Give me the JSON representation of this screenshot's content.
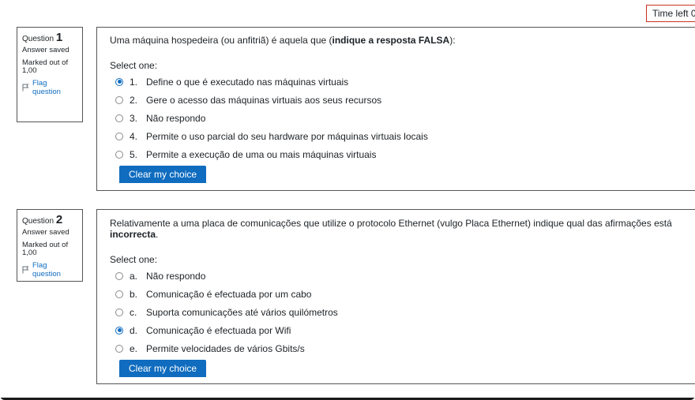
{
  "timer": {
    "text": "Time left 0"
  },
  "questions": [
    {
      "label": "Question",
      "number": "1",
      "state": "Answer saved",
      "grade": "Marked out of 1,00",
      "flag_label": "Flag question",
      "text_before": "Uma máquina hospedeira (ou anfitriã) é aquela que (",
      "text_bold": "indique a resposta FALSA",
      "text_after": "):",
      "prompt": "Select one:",
      "answers": [
        {
          "num": "1.",
          "text": "Define o que é executado nas máquinas virtuais",
          "checked": true
        },
        {
          "num": "2.",
          "text": "Gere o acesso das máquinas virtuais aos seus recursos",
          "checked": false
        },
        {
          "num": "3.",
          "text": "Não respondo",
          "checked": false
        },
        {
          "num": "4.",
          "text": "Permite o uso parcial do seu hardware por máquinas virtuais locais",
          "checked": false
        },
        {
          "num": "5.",
          "text": "Permite a execução de uma ou mais máquinas virtuais",
          "checked": false
        }
      ],
      "clear_label": "Clear my choice"
    },
    {
      "label": "Question",
      "number": "2",
      "state": "Answer saved",
      "grade": "Marked out of 1,00",
      "flag_label": "Flag question",
      "text_before": "Relativamente a uma placa de comunicações que utilize o protocolo Ethernet (vulgo Placa Ethernet) indique qual das afirmações está ",
      "text_bold": "incorrecta",
      "text_after": ".",
      "prompt": "Select one:",
      "answers": [
        {
          "num": "a.",
          "text": "Não respondo",
          "checked": false
        },
        {
          "num": "b.",
          "text": "Comunicação é efectuada por um cabo",
          "checked": false
        },
        {
          "num": "c.",
          "text": "Suporta comunicações até vários quilómetros",
          "checked": false
        },
        {
          "num": "d.",
          "text": "Comunicação é efectuada por Wifi",
          "checked": true
        },
        {
          "num": "e.",
          "text": "Permite velocidades de vários Gbits/s",
          "checked": false
        }
      ],
      "clear_label": "Clear my choice"
    }
  ]
}
